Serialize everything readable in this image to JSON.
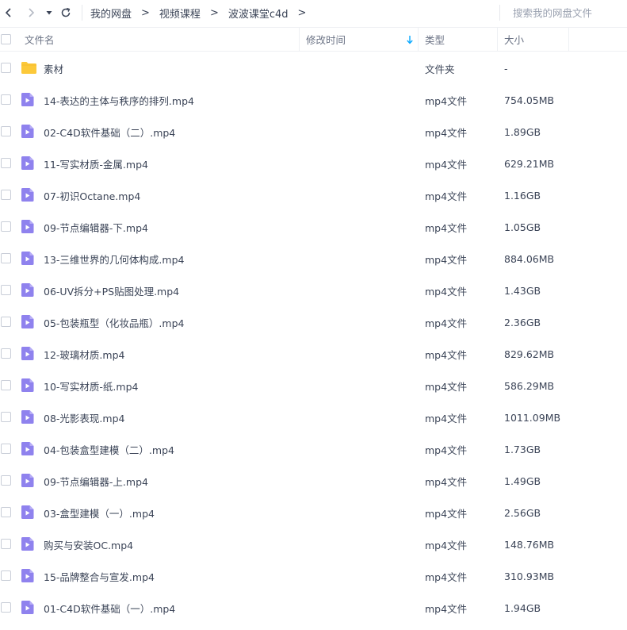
{
  "nav": {
    "back_icon": "chevron-left-icon",
    "forward_icon": "chevron-right-icon",
    "dropdown_icon": "caret-down-icon",
    "refresh_icon": "refresh-icon"
  },
  "breadcrumb": [
    "我的网盘",
    "视频课程",
    "波波课堂c4d"
  ],
  "breadcrumb_separator": ">",
  "search": {
    "placeholder": "搜索我的网盘文件"
  },
  "columns": {
    "name": "文件名",
    "modified": "修改时间",
    "type": "类型",
    "size": "大小"
  },
  "colors": {
    "folder": "#fcc93a",
    "video_icon": "#8f82ee",
    "sort_arrow": "#06a7ff"
  },
  "files": [
    {
      "name": "素材",
      "type": "文件夹",
      "size": "-",
      "icon": "folder-icon"
    },
    {
      "name": "14-表达的主体与秩序的排列.mp4",
      "type": "mp4文件",
      "size": "754.05MB",
      "icon": "video-file-icon"
    },
    {
      "name": "02-C4D软件基础（二）.mp4",
      "type": "mp4文件",
      "size": "1.89GB",
      "icon": "video-file-icon"
    },
    {
      "name": "11-写实材质-金属.mp4",
      "type": "mp4文件",
      "size": "629.21MB",
      "icon": "video-file-icon"
    },
    {
      "name": "07-初识Octane.mp4",
      "type": "mp4文件",
      "size": "1.16GB",
      "icon": "video-file-icon"
    },
    {
      "name": "09-节点编辑器-下.mp4",
      "type": "mp4文件",
      "size": "1.05GB",
      "icon": "video-file-icon"
    },
    {
      "name": "13-三维世界的几何体构成.mp4",
      "type": "mp4文件",
      "size": "884.06MB",
      "icon": "video-file-icon"
    },
    {
      "name": "06-UV拆分+PS贴图处理.mp4",
      "type": "mp4文件",
      "size": "1.43GB",
      "icon": "video-file-icon"
    },
    {
      "name": "05-包装瓶型（化妆品瓶）.mp4",
      "type": "mp4文件",
      "size": "2.36GB",
      "icon": "video-file-icon"
    },
    {
      "name": "12-玻璃材质.mp4",
      "type": "mp4文件",
      "size": "829.62MB",
      "icon": "video-file-icon"
    },
    {
      "name": "10-写实材质-纸.mp4",
      "type": "mp4文件",
      "size": "586.29MB",
      "icon": "video-file-icon"
    },
    {
      "name": "08-光影表现.mp4",
      "type": "mp4文件",
      "size": "1011.09MB",
      "icon": "video-file-icon"
    },
    {
      "name": "04-包装盒型建模（二）.mp4",
      "type": "mp4文件",
      "size": "1.73GB",
      "icon": "video-file-icon"
    },
    {
      "name": "09-节点编辑器-上.mp4",
      "type": "mp4文件",
      "size": "1.49GB",
      "icon": "video-file-icon"
    },
    {
      "name": "03-盒型建模（一）.mp4",
      "type": "mp4文件",
      "size": "2.56GB",
      "icon": "video-file-icon"
    },
    {
      "name": "购买与安装OC.mp4",
      "type": "mp4文件",
      "size": "148.76MB",
      "icon": "video-file-icon"
    },
    {
      "name": "15-品牌整合与宣发.mp4",
      "type": "mp4文件",
      "size": "310.93MB",
      "icon": "video-file-icon"
    },
    {
      "name": "01-C4D软件基础（一）.mp4",
      "type": "mp4文件",
      "size": "1.94GB",
      "icon": "video-file-icon"
    }
  ]
}
